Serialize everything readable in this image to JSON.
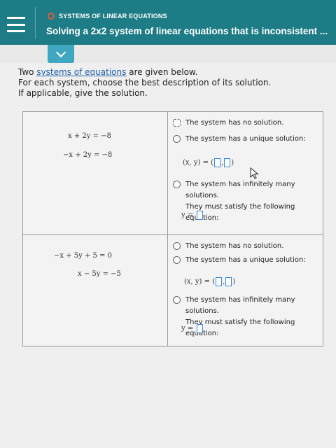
{
  "header": {
    "topic": "SYSTEMS OF LINEAR EQUATIONS",
    "title": "Solving a 2x2 system of linear equations that is inconsistent ..."
  },
  "instructions": {
    "line1_prefix": "Two ",
    "line1_link": "systems of equations",
    "line1_suffix": " are given below.",
    "line2": "For each system, choose the best description of its solution.",
    "line3": "If applicable, give the solution."
  },
  "systems": [
    {
      "eq1": "x + 2y = −8",
      "eq2": "−x + 2y = −8",
      "options": {
        "no_solution": "The system has no solution.",
        "unique": "The system has a unique solution:",
        "coord_prefix": "(x, y) = (",
        "coord_sep": ",",
        "coord_suffix": ")",
        "infinite_line1": "The system has infinitely many solutions.",
        "infinite_line2": "They must satisfy the following equation:",
        "y_prefix": "y ="
      }
    },
    {
      "eq1": "−x + 5y + 5 = 0",
      "eq2": "x − 5y = −5",
      "options": {
        "no_solution": "The system has no solution.",
        "unique": "The system has a unique solution:",
        "coord_prefix": "(x, y) = (",
        "coord_sep": ",",
        "coord_suffix": ")",
        "infinite_line1": "The system has infinitely many solutions.",
        "infinite_line2": "They must satisfy the following equation:",
        "y_prefix": "y ="
      }
    }
  ],
  "colors": {
    "header": "#1e7c86",
    "accent": "#3fa8c0",
    "answer_box": "#3a86d8",
    "topic_dot": "#e05a3c"
  }
}
